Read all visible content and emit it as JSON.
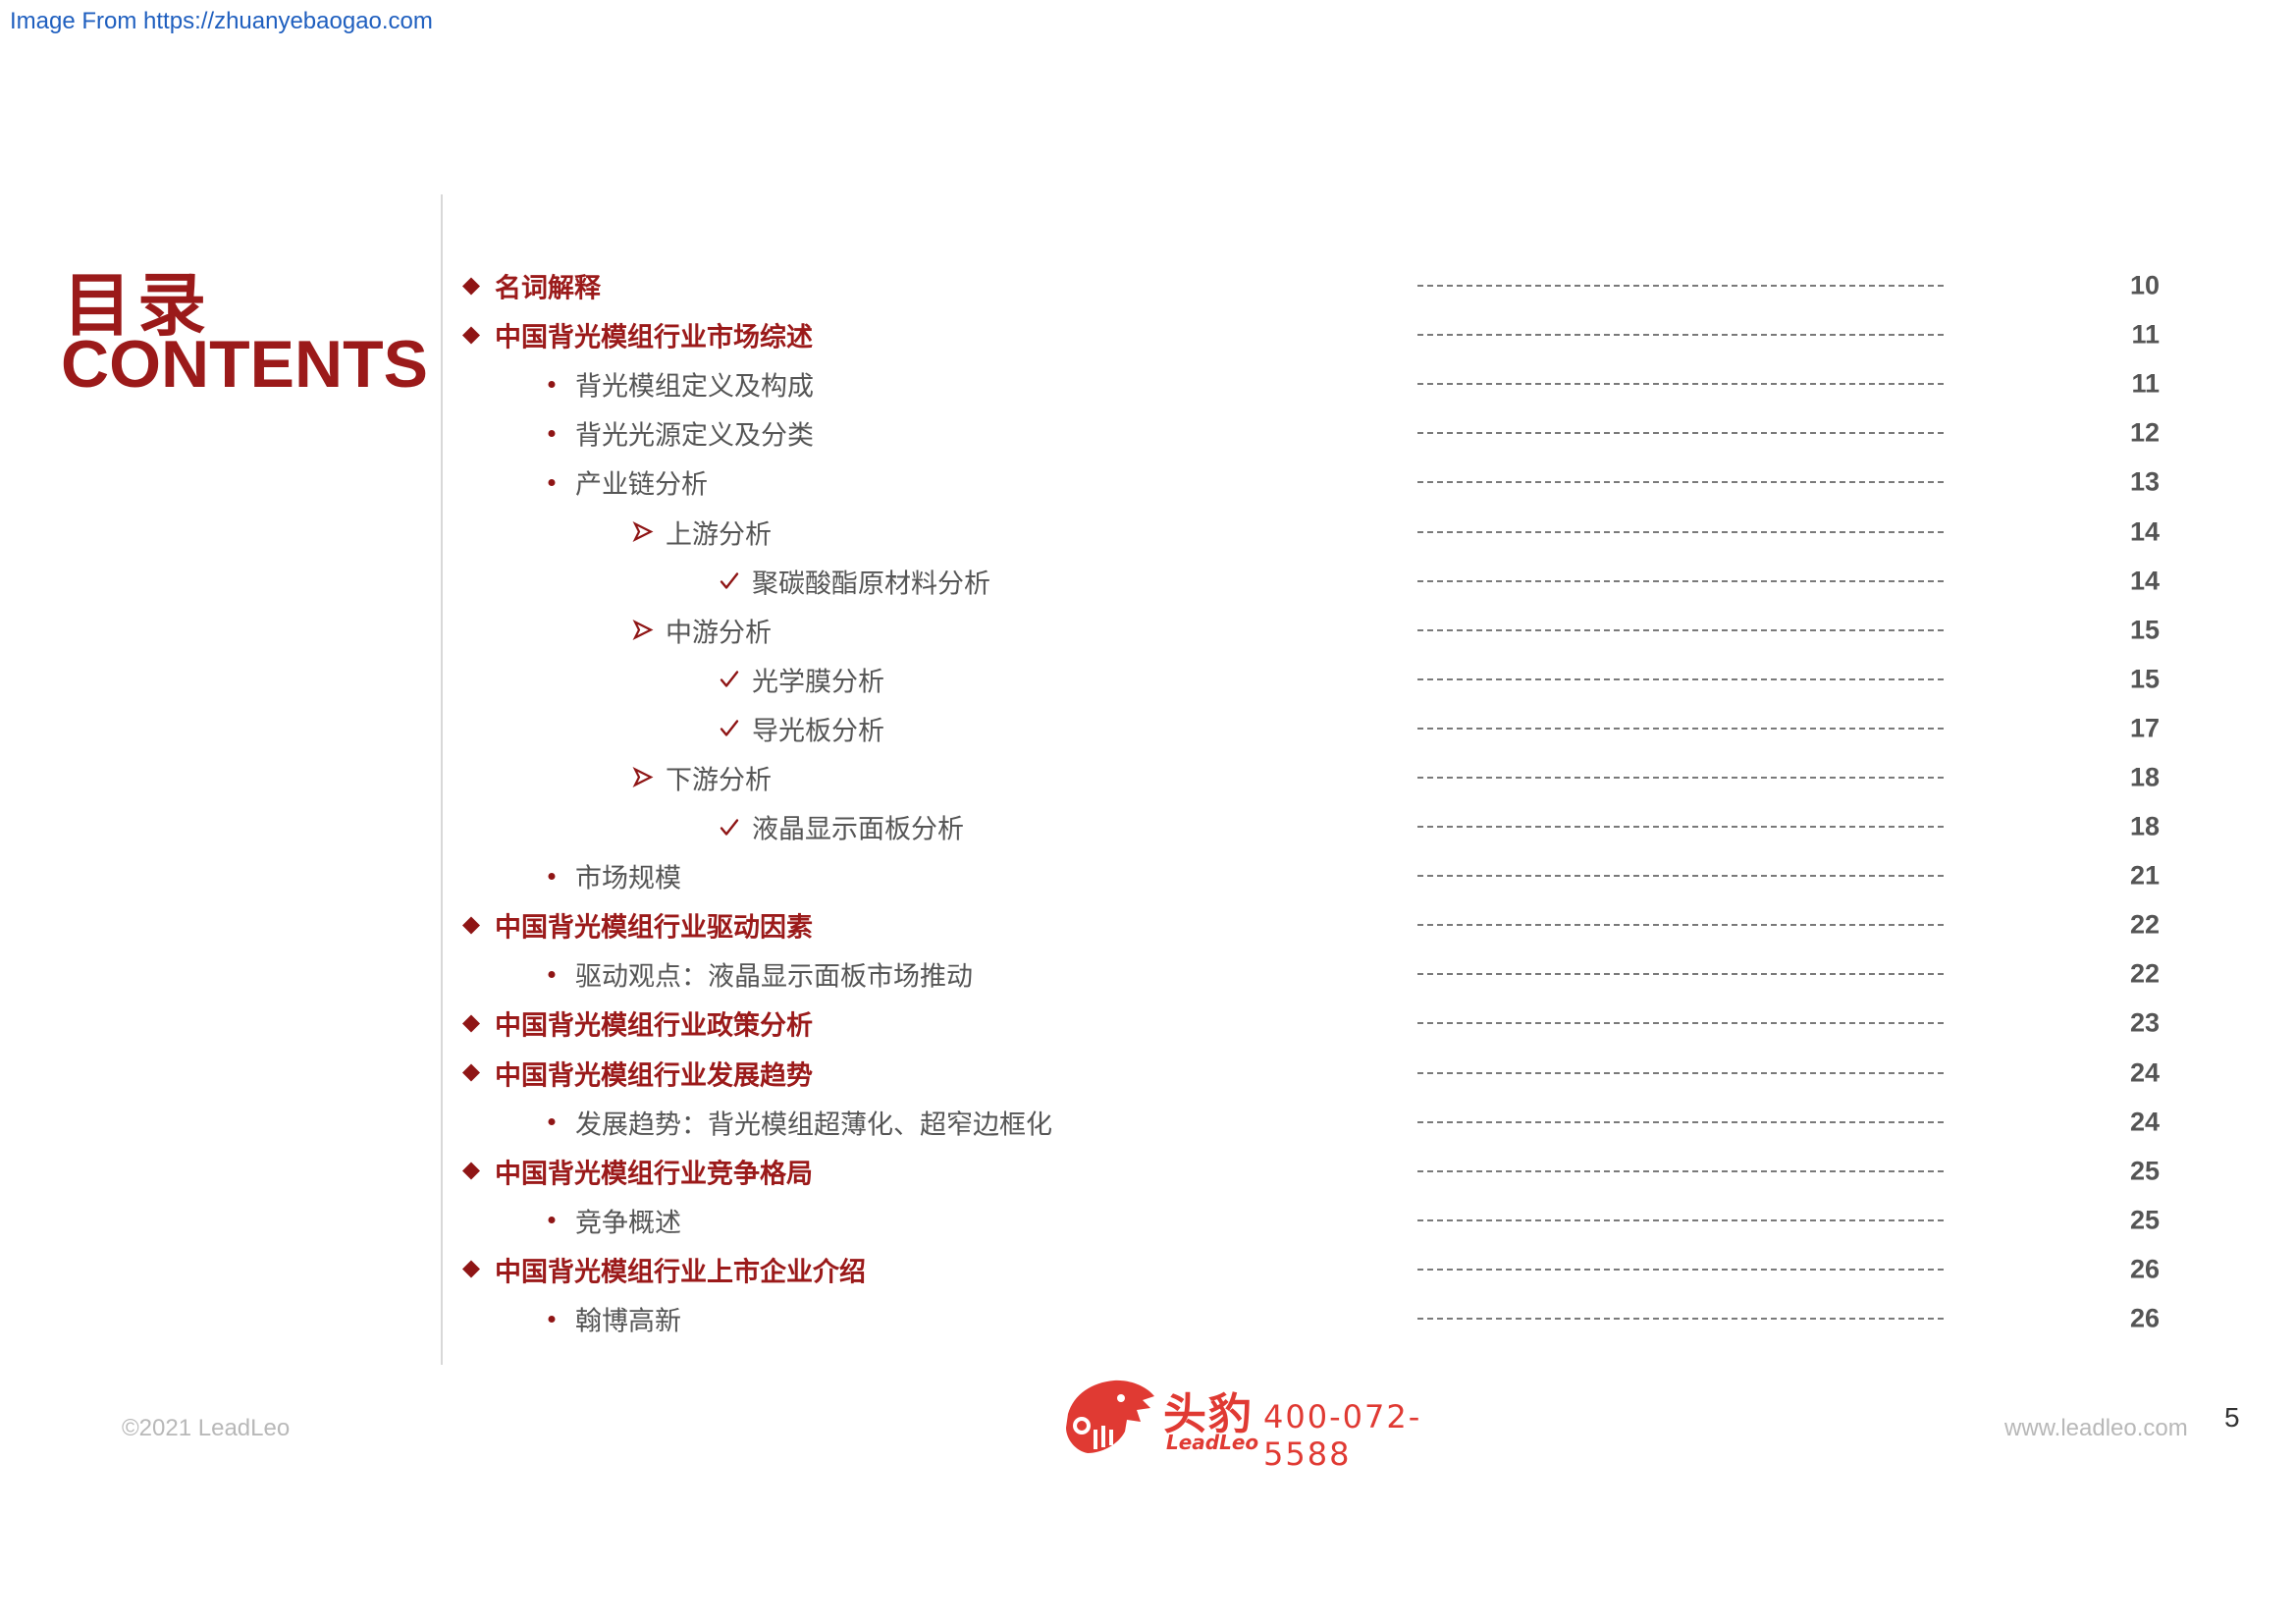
{
  "watermark": "Image From https://zhuanyebaogao.com",
  "title_cn": "目录",
  "title_en": "CONTENTS",
  "toc": [
    {
      "level": 1,
      "label": "名词解释",
      "page": "10"
    },
    {
      "level": 1,
      "label": "中国背光模组行业市场综述",
      "page": "11"
    },
    {
      "level": 2,
      "label": "背光模组定义及构成",
      "page": "11"
    },
    {
      "level": 2,
      "label": "背光光源定义及分类",
      "page": "12"
    },
    {
      "level": 2,
      "label": "产业链分析",
      "page": "13"
    },
    {
      "level": 3,
      "label": "上游分析",
      "page": "14"
    },
    {
      "level": 4,
      "label": "聚碳酸酯原材料分析",
      "page": "14"
    },
    {
      "level": 3,
      "label": "中游分析",
      "page": "15"
    },
    {
      "level": 4,
      "label": "光学膜分析",
      "page": "15"
    },
    {
      "level": 4,
      "label": "导光板分析",
      "page": "17"
    },
    {
      "level": 3,
      "label": "下游分析",
      "page": "18"
    },
    {
      "level": 4,
      "label": "液晶显示面板分析",
      "page": "18"
    },
    {
      "level": 2,
      "label": "市场规模",
      "page": "21"
    },
    {
      "level": 1,
      "label": "中国背光模组行业驱动因素",
      "page": "22"
    },
    {
      "level": 2,
      "label": "驱动观点：液晶显示面板市场推动",
      "page": "22"
    },
    {
      "level": 1,
      "label": "中国背光模组行业政策分析",
      "page": "23"
    },
    {
      "level": 1,
      "label": "中国背光模组行业发展趋势",
      "page": "24"
    },
    {
      "level": 2,
      "label": "发展趋势：背光模组超薄化、超窄边框化",
      "page": "24"
    },
    {
      "level": 1,
      "label": "中国背光模组行业竞争格局",
      "page": "25"
    },
    {
      "level": 2,
      "label": "竞争概述",
      "page": "25"
    },
    {
      "level": 1,
      "label": "中国背光模组行业上市企业介绍",
      "page": "26"
    },
    {
      "level": 2,
      "label": "翰博高新",
      "page": "26"
    }
  ],
  "leader_text": "--------------------------------------",
  "footer": {
    "copyright": "©2021 LeadLeo",
    "logo_cn": "头豹",
    "logo_en": "LeadLeo",
    "phone": "400-072-5588",
    "website": "www.leadleo.com",
    "page_number": "5"
  },
  "colors": {
    "accent": "#9b1a1a",
    "logo": "#e03a33",
    "text": "#555555",
    "watermark": "#1f5fbf"
  }
}
